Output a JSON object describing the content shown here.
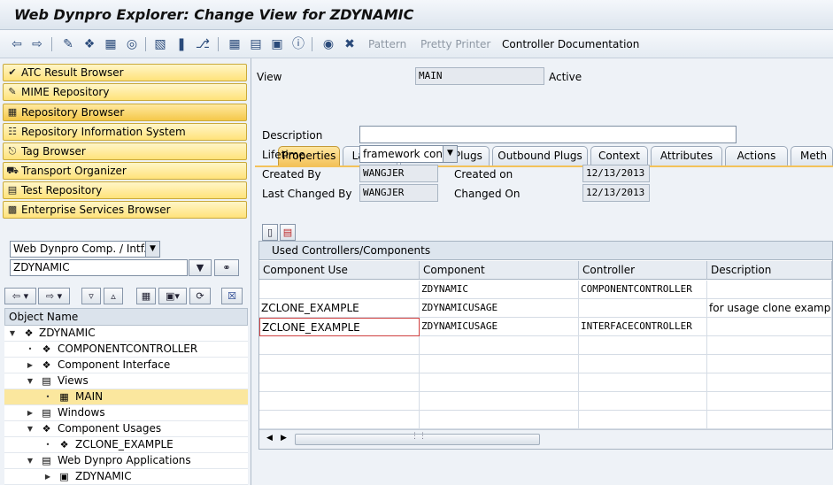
{
  "window": {
    "title": "Web Dynpro Explorer: Change View for ZDYNAMIC"
  },
  "toolbar": {
    "icons": [
      "back-arrow-icon",
      "forward-arrow-icon",
      "edit-pencil-icon",
      "object-icon",
      "hierarchy-icon",
      "where-used-icon",
      "check-icon",
      "activate-icon",
      "test-icon",
      "tree-icon",
      "stack-icon",
      "display-icon",
      "info-icon",
      "breakpoint-icon",
      "stop-icon"
    ],
    "pattern_label": "Pattern",
    "pretty_printer_label": "Pretty Printer",
    "controller_doc_label": "Controller Documentation"
  },
  "nav": {
    "buttons": [
      {
        "label": "ATC Result Browser",
        "icon": "atc-icon"
      },
      {
        "label": "MIME Repository",
        "icon": "mime-icon"
      },
      {
        "label": "Repository Browser",
        "icon": "repository-icon"
      },
      {
        "label": "Repository Information System",
        "icon": "info-system-icon"
      },
      {
        "label": "Tag Browser",
        "icon": "tag-icon"
      },
      {
        "label": "Transport Organizer",
        "icon": "truck-icon"
      },
      {
        "label": "Test Repository",
        "icon": "test-repo-icon"
      },
      {
        "label": "Enterprise Services Browser",
        "icon": "services-icon"
      }
    ]
  },
  "objselect": {
    "type_value": "Web Dynpro Comp. / Intf.",
    "name_value": "ZDYNAMIC"
  },
  "objlist": {
    "header": "Object Name",
    "rows": [
      {
        "label": "ZDYNAMIC",
        "icon": "component-icon"
      },
      {
        "label": "COMPONENTCONTROLLER",
        "icon": "controller-icon"
      },
      {
        "label": "Component Interface",
        "icon": "interface-icon"
      },
      {
        "label": "Views",
        "icon": "folder-icon"
      },
      {
        "label": "MAIN",
        "icon": "view-icon"
      },
      {
        "label": "Windows",
        "icon": "folder-icon"
      },
      {
        "label": "Component Usages",
        "icon": "usage-icon"
      },
      {
        "label": "ZCLONE_EXAMPLE",
        "icon": "usage-item-icon"
      },
      {
        "label": "Web Dynpro Applications",
        "icon": "app-folder-icon"
      },
      {
        "label": "ZDYNAMIC",
        "icon": "application-icon"
      }
    ]
  },
  "view": {
    "label": "View",
    "name": "MAIN",
    "status": "Active"
  },
  "tabs": [
    "Properties",
    "Layout",
    "Inbound Plugs",
    "Outbound Plugs",
    "Context",
    "Attributes",
    "Actions",
    "Meth"
  ],
  "props": {
    "description_label": "Description",
    "description_value": "",
    "lifetime_label": "Lifetime",
    "lifetime_value": "framework con…",
    "created_by_label": "Created By",
    "created_by_value": "WANGJER",
    "created_on_label": "Created on",
    "created_on_value": "12/13/2013",
    "last_changed_by_label": "Last Changed By",
    "last_changed_by_value": "WANGJER",
    "changed_on_label": "Changed On",
    "changed_on_value": "12/13/2013"
  },
  "usedtable": {
    "caption": "Used Controllers/Components",
    "headers": [
      "Component Use",
      "Component",
      "Controller",
      "Description"
    ],
    "rows": [
      [
        "",
        "ZDYNAMIC",
        "COMPONENTCONTROLLER",
        ""
      ],
      [
        "ZCLONE_EXAMPLE",
        "ZDYNAMICUSAGE",
        "",
        "for usage clone example"
      ],
      [
        "ZCLONE_EXAMPLE",
        "ZDYNAMICUSAGE",
        "INTERFACECONTROLLER",
        ""
      ]
    ]
  }
}
